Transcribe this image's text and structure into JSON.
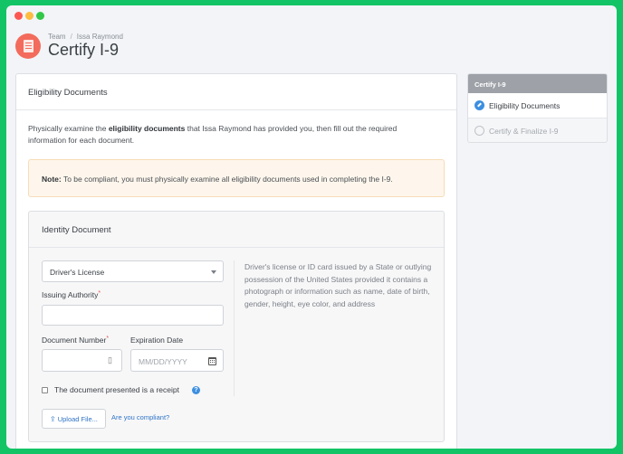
{
  "breadcrumb": {
    "parent": "Team",
    "separator": "/",
    "current": "Issa Raymond"
  },
  "page": {
    "title": "Certify I-9"
  },
  "main": {
    "section_title": "Eligibility Documents",
    "intro_before": "Physically examine the ",
    "intro_bold": "eligibility documents",
    "intro_after": " that Issa Raymond has provided you, then fill out the required information for each document.",
    "note_label": "Note:",
    "note_text": " To be compliant, you must physically examine all eligibility documents used in completing the I-9."
  },
  "identity": {
    "title": "Identity Document",
    "doc_type": "Driver's License",
    "issuing_authority_label": "Issuing Authority",
    "issuing_authority_value": "",
    "document_number_label": "Document Number",
    "document_number_value": "",
    "expiration_label": "Expiration Date",
    "expiration_placeholder": "MM/DD/YYYY",
    "required_marker": "*",
    "description": "Driver's license or ID card issued by a State or outlying possession of the United States provided it contains a photograph or information such as name, date of birth, gender, height, eye color, and address",
    "receipt_label": "The document presented is a receipt",
    "help_symbol": "?",
    "upload_label": "Upload File...",
    "compliance_link": "Are you compliant?"
  },
  "sidebar": {
    "header": "Certify I-9",
    "steps": [
      {
        "label": "Eligibility Documents",
        "state": "active"
      },
      {
        "label": "Certify & Finalize I-9",
        "state": "pending"
      }
    ]
  },
  "colors": {
    "accent": "#3d8fe0",
    "brand_icon": "#f36b5c",
    "frame": "#12c466"
  }
}
